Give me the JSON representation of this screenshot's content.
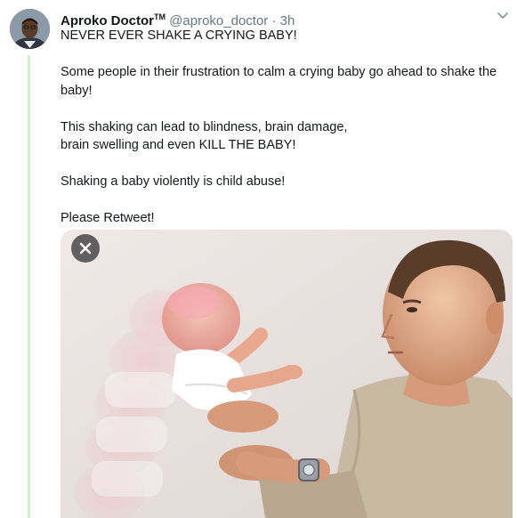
{
  "tweet": {
    "author": {
      "display_name": "Aproko Doctor",
      "badge": "TM",
      "handle": "@aproko_doctor",
      "separator": "·",
      "timestamp": "3h"
    },
    "lines": [
      "NEVER EVER SHAKE A CRYING BABY!",
      "",
      "Some people in their frustration to calm a crying baby go ahead to shake the baby!",
      "",
      "This shaking can lead to blindness, brain damage,",
      "brain swelling and even KILL THE BABY!",
      "",
      "Shaking a baby violently is child abuse!",
      "",
      "Please Retweet!"
    ],
    "media": {
      "icon": "close-icon"
    }
  },
  "colors": {
    "thread_line": "#d6ecd0",
    "muted_text": "#657786",
    "text": "#14171a",
    "media_background": "#e9e3e1"
  }
}
